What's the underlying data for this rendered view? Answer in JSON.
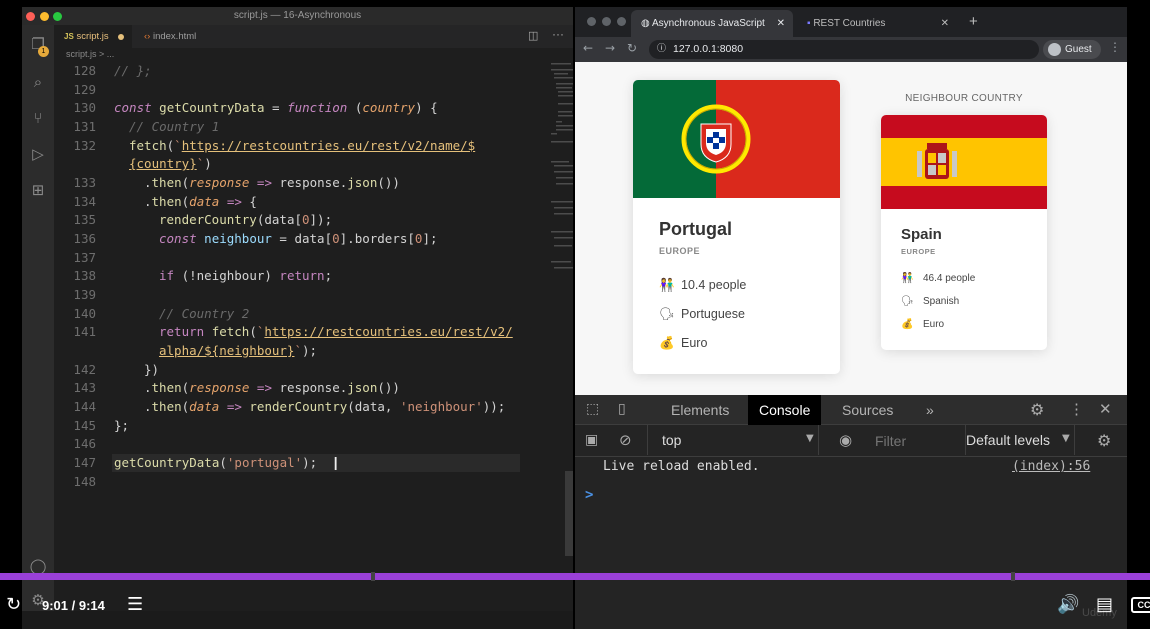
{
  "vscode": {
    "window_title": "script.js — 16-Asynchronous",
    "tabs": [
      {
        "label": "script.js",
        "badge": "JS",
        "modified": true
      },
      {
        "label": "index.html"
      }
    ],
    "breadcrumb": "script.js > ...",
    "explorer_badge": "1",
    "code_lines": [
      {
        "num": "128",
        "text": "// };"
      },
      {
        "num": "129",
        "text": ""
      },
      {
        "num": "130",
        "text": "const getCountryData = function (country) {"
      },
      {
        "num": "131",
        "text": "// Country 1"
      },
      {
        "num": "132",
        "text": "fetch(`https://restcountries.eu/rest/v2/name/${country}`)"
      },
      {
        "num": "133",
        "text": ".then(response => response.json())"
      },
      {
        "num": "134",
        "text": ".then(data => {"
      },
      {
        "num": "135",
        "text": "renderCountry(data[0]);"
      },
      {
        "num": "136",
        "text": "const neighbour = data[0].borders[0];"
      },
      {
        "num": "137",
        "text": ""
      },
      {
        "num": "138",
        "text": "if (!neighbour) return;"
      },
      {
        "num": "139",
        "text": ""
      },
      {
        "num": "140",
        "text": "// Country 2"
      },
      {
        "num": "141",
        "text": "return fetch(`https://restcountries.eu/rest/v2/alpha/${neighbour}`);"
      },
      {
        "num": "142",
        "text": "})"
      },
      {
        "num": "143",
        "text": ".then(response => response.json())"
      },
      {
        "num": "144",
        "text": ".then(data => renderCountry(data, 'neighbour'));"
      },
      {
        "num": "145",
        "text": "};"
      },
      {
        "num": "146",
        "text": ""
      },
      {
        "num": "147",
        "text": "getCountryData('portugal');"
      },
      {
        "num": "148",
        "text": ""
      }
    ]
  },
  "browser": {
    "tabs": [
      {
        "label": "Asynchronous JavaScript",
        "active": true
      },
      {
        "label": "REST Countries",
        "active": false
      }
    ],
    "new_tab": "+",
    "url": "127.0.0.1:8080",
    "profile_label": "Guest",
    "page": {
      "main_country": {
        "name": "Portugal",
        "region": "EUROPE",
        "population": "10.4 people",
        "language": "Portuguese",
        "currency": "Euro"
      },
      "neighbour_heading": "NEIGHBOUR COUNTRY",
      "neighbour_country": {
        "name": "Spain",
        "region": "EUROPE",
        "population": "46.4 people",
        "language": "Spanish",
        "currency": "Euro"
      }
    },
    "devtools": {
      "tabs": [
        "Elements",
        "Console",
        "Sources"
      ],
      "more_tabs": "»",
      "active_tab": "Console",
      "context": "top",
      "filter_placeholder": "Filter",
      "levels": "Default levels",
      "log_message": "Live reload enabled.",
      "log_source": "(index):56",
      "prompt": ">"
    }
  },
  "player": {
    "time": "9:01 / 9:14",
    "progress": 0.98,
    "watermark": "Udemy",
    "accent": "#9a40d8"
  }
}
